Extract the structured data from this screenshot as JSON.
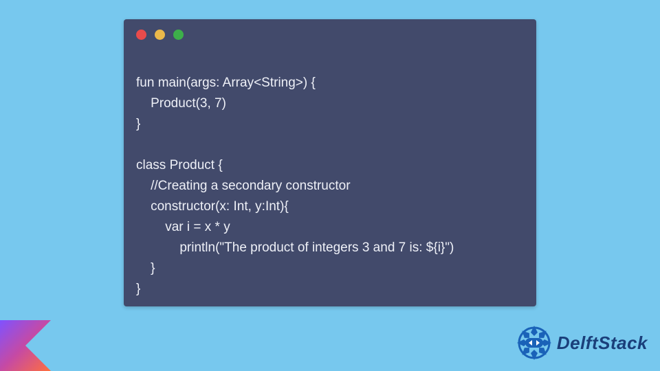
{
  "code": {
    "lines": [
      "fun main(args: Array<String>) {",
      "    Product(3, 7)",
      "}",
      "",
      "class Product {",
      "    //Creating a secondary constructor",
      "    constructor(x: Int, y:Int){",
      "        var i = x * y",
      "            println(\"The product of integers 3 and 7 is: ${i}\")",
      "    }",
      "}"
    ]
  },
  "window": {
    "buttons": {
      "red": "close",
      "yellow": "minimize",
      "green": "zoom"
    }
  },
  "brand": {
    "name": "DelftStack",
    "kotlin_alt": "Kotlin"
  }
}
